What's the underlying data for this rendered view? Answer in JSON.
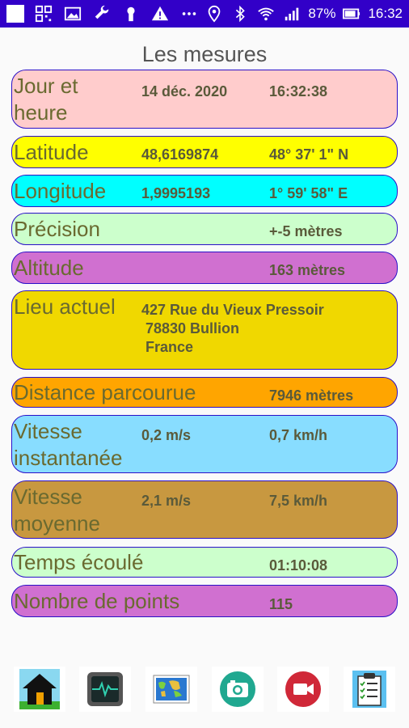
{
  "status": {
    "battery": "87%",
    "time": "16:32"
  },
  "title": "Les mesures",
  "rows": [
    {
      "label": "Jour et\nheure",
      "v1": "14 déc. 2020",
      "v2": "16:32:38",
      "bg": "#ffcccc"
    },
    {
      "label": "Latitude",
      "v1": "48,6169874",
      "v2": "48° 37' 1\" N",
      "bg": "#ffff00"
    },
    {
      "label": "Longitude",
      "v1": "1,9995193",
      "v2": "1° 59' 58\" E",
      "bg": "#00ffff"
    },
    {
      "label": "Précision",
      "v1": "",
      "v2": "+-5 mètres",
      "bg": "#ccffcc"
    },
    {
      "label": "Altitude",
      "v1": "",
      "v2": "163 mètres",
      "bg": "#d070d0"
    },
    {
      "label": "Lieu actuel",
      "address": "427 Rue du Vieux Pressoir\n 78830 Bullion\n France",
      "bg": "#f0d800"
    },
    {
      "label": "Distance parcourue",
      "v1": "",
      "v2": "7946 mètres",
      "bg": "#ffa500"
    },
    {
      "label": "Vitesse\ninstantanée",
      "v1": "0,2 m/s",
      "v2": "0,7 km/h",
      "bg": "#88ddff"
    },
    {
      "label": "Vitesse\nmoyenne",
      "v1": "2,1 m/s",
      "v2": "7,5 km/h",
      "bg": "#c89840"
    },
    {
      "label": "Temps écoulé",
      "v1": "",
      "v2": "01:10:08",
      "bg": "#ccffcc"
    },
    {
      "label": "Nombre de points",
      "v1": "",
      "v2": "115",
      "bg": "#d070d0"
    }
  ],
  "nav": [
    {
      "name": "home-icon"
    },
    {
      "name": "monitor-icon"
    },
    {
      "name": "map-icon"
    },
    {
      "name": "camera-icon"
    },
    {
      "name": "video-icon"
    },
    {
      "name": "clipboard-icon"
    }
  ]
}
